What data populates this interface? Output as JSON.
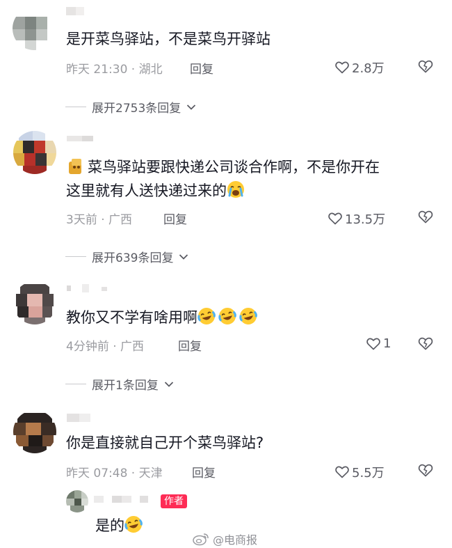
{
  "comments": [
    {
      "text": "是开菜鸟驿站，不是菜鸟开驿站",
      "meta": "昨天 21:30 · 湖北",
      "reply_label": "回复",
      "likes": "2.8万",
      "expand_label": "展开2753条回复"
    },
    {
      "text_line1": "菜鸟驿站要跟快递公司谈合作啊，不是你开在",
      "text_line2": "这里就有人送快递过来的",
      "meta": "3天前 · 广西",
      "reply_label": "回复",
      "likes": "13.5万",
      "expand_label": "展开639条回复"
    },
    {
      "text": "教你又不学有啥用啊",
      "meta": "4分钟前 · 广西",
      "reply_label": "回复",
      "likes": "1",
      "expand_label": "展开1条回复"
    },
    {
      "text": "你是直接就自己开个菜鸟驿站?",
      "meta": "昨天 07:48 · 天津",
      "reply_label": "回复",
      "likes": "5.5万"
    }
  ],
  "author_reply": {
    "badge": "作者",
    "text": "是的"
  },
  "watermark": "@电商报",
  "colors": {
    "text": "#161823",
    "meta": "#9a9ba0",
    "accent": "#fe2c55"
  },
  "icons": {
    "like": "heart-outline-icon",
    "dislike": "broken-heart-icon",
    "expand": "chevron-down-icon",
    "emoji_laugh": "tears-of-joy-emoji",
    "emoji_cry": "crying-emoji"
  }
}
